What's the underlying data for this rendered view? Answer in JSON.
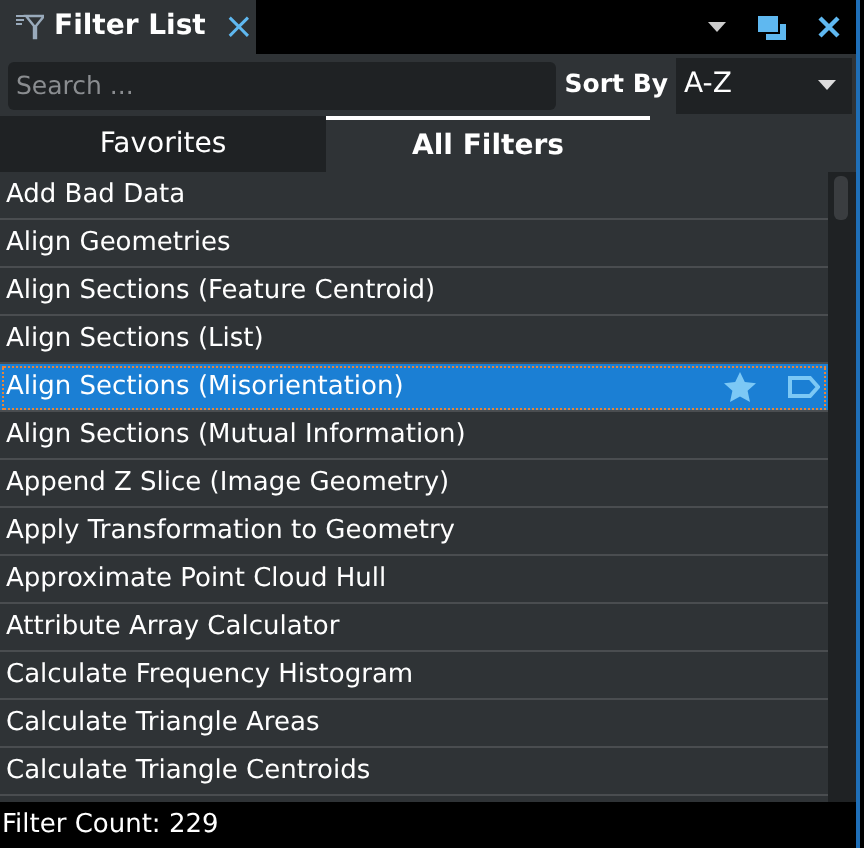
{
  "panel": {
    "title": "Filter List",
    "close": "×"
  },
  "search": {
    "placeholder": "Search ..."
  },
  "sort": {
    "label": "Sort By",
    "value": "A-Z"
  },
  "tabs": [
    {
      "label": "Favorites",
      "selected": false
    },
    {
      "label": "All Filters",
      "selected": true
    }
  ],
  "filters": [
    {
      "name": "Add Bad Data",
      "selected": false
    },
    {
      "name": "Align Geometries",
      "selected": false
    },
    {
      "name": "Align Sections (Feature Centroid)",
      "selected": false
    },
    {
      "name": "Align Sections (List)",
      "selected": false
    },
    {
      "name": "Align Sections (Misorientation)",
      "selected": true
    },
    {
      "name": "Align Sections (Mutual Information)",
      "selected": false
    },
    {
      "name": "Append Z Slice (Image Geometry)",
      "selected": false
    },
    {
      "name": "Apply Transformation to Geometry",
      "selected": false
    },
    {
      "name": "Approximate Point Cloud Hull",
      "selected": false
    },
    {
      "name": "Attribute Array Calculator",
      "selected": false
    },
    {
      "name": "Calculate Frequency Histogram",
      "selected": false
    },
    {
      "name": "Calculate Triangle Areas",
      "selected": false
    },
    {
      "name": "Calculate Triangle Centroids",
      "selected": false
    }
  ],
  "status": "Filter Count: 229"
}
